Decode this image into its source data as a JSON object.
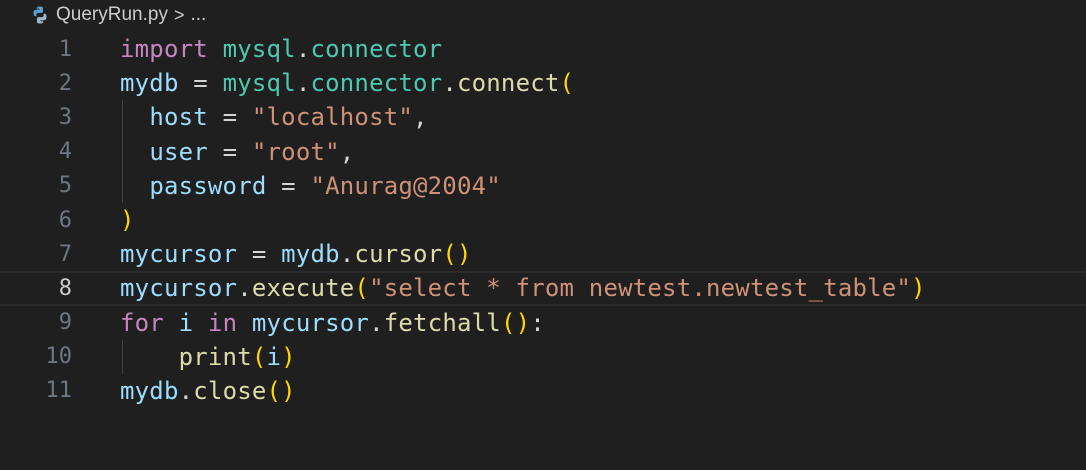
{
  "breadcrumb": {
    "filename": "QueryRun.py",
    "separator": ">",
    "ellipsis": "..."
  },
  "colors": {
    "background": "#1f1f1f",
    "keyword": "#c586c0",
    "module": "#4ec9b0",
    "variable": "#9cdcfe",
    "function": "#dcdcaa",
    "string": "#ce9178",
    "bracket": "#ffd700",
    "line_number": "#6e7681"
  },
  "active_line": 8,
  "lines": [
    {
      "n": "1",
      "tokens": [
        [
          "kw-import",
          "import"
        ],
        [
          "op",
          " "
        ],
        [
          "mod",
          "mysql"
        ],
        [
          "op",
          "."
        ],
        [
          "mod",
          "connector"
        ]
      ]
    },
    {
      "n": "2",
      "tokens": [
        [
          "var",
          "mydb"
        ],
        [
          "op",
          " = "
        ],
        [
          "mod",
          "mysql"
        ],
        [
          "op",
          "."
        ],
        [
          "mod",
          "connector"
        ],
        [
          "op",
          "."
        ],
        [
          "fn",
          "connect"
        ],
        [
          "paren",
          "("
        ]
      ]
    },
    {
      "n": "3",
      "tokens": [
        [
          "op",
          "  "
        ],
        [
          "var",
          "host"
        ],
        [
          "op",
          " = "
        ],
        [
          "str",
          "\"localhost\""
        ],
        [
          "op",
          ","
        ]
      ]
    },
    {
      "n": "4",
      "tokens": [
        [
          "op",
          "  "
        ],
        [
          "var",
          "user"
        ],
        [
          "op",
          " = "
        ],
        [
          "str",
          "\"root\""
        ],
        [
          "op",
          ","
        ]
      ]
    },
    {
      "n": "5",
      "tokens": [
        [
          "op",
          "  "
        ],
        [
          "var",
          "password"
        ],
        [
          "op",
          " = "
        ],
        [
          "str",
          "\"Anurag@2004\""
        ]
      ]
    },
    {
      "n": "6",
      "tokens": [
        [
          "paren",
          ")"
        ]
      ]
    },
    {
      "n": "7",
      "tokens": [
        [
          "var",
          "mycursor"
        ],
        [
          "op",
          " = "
        ],
        [
          "var",
          "mydb"
        ],
        [
          "op",
          "."
        ],
        [
          "fn",
          "cursor"
        ],
        [
          "paren",
          "()"
        ]
      ]
    },
    {
      "n": "8",
      "tokens": [
        [
          "var",
          "mycursor"
        ],
        [
          "op",
          "."
        ],
        [
          "fn",
          "execute"
        ],
        [
          "paren",
          "("
        ],
        [
          "str",
          "\"select * from newtest.newtest_table\""
        ],
        [
          "paren",
          ")"
        ]
      ]
    },
    {
      "n": "9",
      "tokens": [
        [
          "kw-ctrl",
          "for"
        ],
        [
          "op",
          " "
        ],
        [
          "var",
          "i"
        ],
        [
          "op",
          " "
        ],
        [
          "kw-ctrl",
          "in"
        ],
        [
          "op",
          " "
        ],
        [
          "var",
          "mycursor"
        ],
        [
          "op",
          "."
        ],
        [
          "fn",
          "fetchall"
        ],
        [
          "paren",
          "()"
        ],
        [
          "op",
          ":"
        ]
      ]
    },
    {
      "n": "10",
      "tokens": [
        [
          "op",
          "    "
        ],
        [
          "fn",
          "print"
        ],
        [
          "paren",
          "("
        ],
        [
          "var",
          "i"
        ],
        [
          "paren",
          ")"
        ]
      ]
    },
    {
      "n": "11",
      "tokens": [
        [
          "var",
          "mydb"
        ],
        [
          "op",
          "."
        ],
        [
          "fn",
          "close"
        ],
        [
          "paren",
          "()"
        ]
      ]
    }
  ]
}
